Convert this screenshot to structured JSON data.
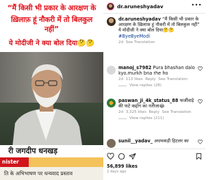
{
  "media": {
    "caption_line1": "“मैं किसी भी प्रकार के आरक्षण के",
    "caption_line2": "ख़िलाफ़ हूं नौकरी में तो बिलकुल",
    "caption_line3": "नहीं”",
    "caption_line4": "ये मोदीजी ने क्या बोल दिया",
    "caption_emoji": "🤔🤔",
    "lower_third_name": "री जगदीप धनखड़",
    "lower_third_role": "nister",
    "lower_third_sub": "ति के अभिभाषण पर धन्यवाद प्रस्ताव"
  },
  "header": {
    "username": "dr.aruneshyadav",
    "more_icon": "more-horizontal-icon"
  },
  "post": {
    "author": "dr.aruneshyadav",
    "text": "“मैं किसी भी प्रकार के आरक्षण के ख़िलाफ़ हूं नौकरी में तो बिलकुल नहीं” ये मोदीजी ने क्या बोल दिया",
    "emoji": "🤔🤔",
    "hashtag": "#ByeByeModi",
    "time": "2d",
    "see_translation": "See Translation"
  },
  "comments": [
    {
      "author": "manoj_s7982",
      "text": "Pura bhashan dalo kyo.murkh bna rhe ho",
      "time": "2d",
      "likes": "113 likes",
      "reply": "Reply",
      "see_translation": "See Translation",
      "view_replies": "View replies (28)"
    },
    {
      "author": "paswan_ji_4k_status_88",
      "text": "फर्जीवाड़े की फटे कद्दोग का नतीजा",
      "emoji": "😂",
      "time": "2d",
      "likes": "3,325 likes",
      "reply": "Reply",
      "see_translation": "See Translation",
      "view_replies": "View replies (211)"
    },
    {
      "author": "sunil__yadav_",
      "text": "अधभकड़ी हिटलर का"
    }
  ],
  "footer": {
    "likes": "56,899 likes",
    "date": "2 days ago"
  },
  "colors": {
    "caption_red": "#e3121b",
    "text_primary": "#111111",
    "text_secondary": "#8e8e8e",
    "hashtag_blue": "#0b3d91"
  }
}
